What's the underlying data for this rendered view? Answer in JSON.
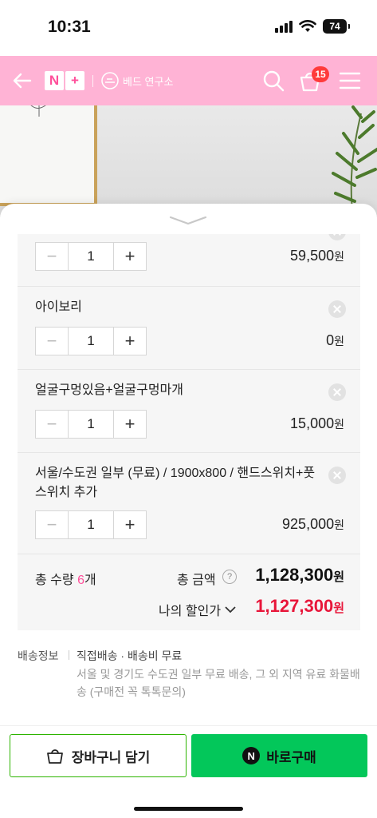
{
  "status_bar": {
    "time": "10:31",
    "battery": "74"
  },
  "header": {
    "npay_n": "N",
    "npay_plus": "+",
    "store_name": "베드 연구소",
    "cart_count": "15",
    "brand_color": "#ffb3d5"
  },
  "options": [
    {
      "name": "",
      "qty": "1",
      "price": "59,500",
      "won": "원"
    },
    {
      "name": "아이보리",
      "qty": "1",
      "price": "0",
      "won": "원"
    },
    {
      "name": "얼굴구멍있음+얼굴구멍마개",
      "qty": "1",
      "price": "15,000",
      "won": "원"
    },
    {
      "name": "서울/수도권 일부 (무료) / 1900x800 / 핸드스위치+풋스위치 추가",
      "qty": "1",
      "price": "925,000",
      "won": "원"
    }
  ],
  "stepper": {
    "minus": "−",
    "plus": "+"
  },
  "totals": {
    "qty_label": "총 수량 ",
    "qty_value": "6",
    "qty_unit": "개",
    "amount_label": "총 금액",
    "help": "?",
    "amount": "1,128,300",
    "won": "원",
    "discount_label": "나의 할인가",
    "discount_amount": "1,127,300",
    "discount_color": "#e8163a"
  },
  "shipping": {
    "label": "배송정보",
    "main": "직접배송 · 배송비 무료",
    "note": "서울 및 경기도 수도권 일부 무료 배송, 그 외 지역 유료 화물배송 (구매전 꼭 톡톡문의)"
  },
  "actions": {
    "cart_label": "장바구니 담기",
    "buy_badge": "N",
    "buy_label": "바로구매",
    "buy_color": "#03c75a"
  }
}
